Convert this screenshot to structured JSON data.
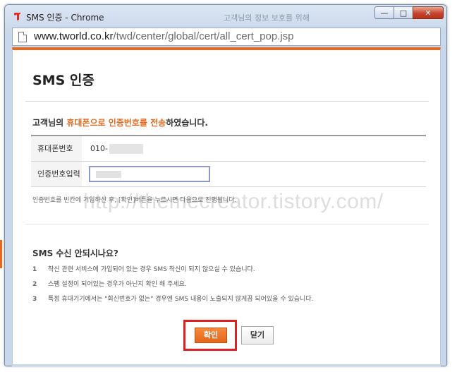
{
  "window": {
    "title": "SMS 인증 - Chrome",
    "background_tab_text": "고객님의 정보 보호를 위해",
    "controls": {
      "minimize": "—",
      "maximize": "□",
      "close": "✕"
    }
  },
  "address": {
    "domain": "www.tworld.co.kr",
    "path": "/twd/center/global/cert/all_cert_pop.jsp"
  },
  "popup": {
    "title": "SMS 인증",
    "notice": {
      "prefix": "고객님의 ",
      "highlight1": "휴대폰으로 인증번호를 전송",
      "suffix": "하였습니다."
    },
    "form": {
      "phone_label": "휴대폰번호",
      "phone_value": "010-",
      "code_label": "인증번호입력",
      "code_placeholder": ""
    },
    "help_text": "인증번호를 빈칸에 기입하신 후, [확인]버튼을 누르시면 다음으로 진행됩니다.",
    "watermark": "http://themecreator.tistory.com/",
    "faq": {
      "title": "SMS 수신 안되시나요?",
      "items": [
        {
          "num": "1",
          "text": "착신 관련 서비스에 가입되어 있는 경우 SMS 착신이 되지 않으실 수 있습니다."
        },
        {
          "num": "2",
          "text": "스팸 설정이 되어있는 경우가 아닌지 확인 해 주세요."
        },
        {
          "num": "3",
          "text": "특정 휴대기기에서는 \"회신번호가 없는\" 경우엔 SMS 내용이 노출되지 않게끔 되어있을 수 있습니다."
        }
      ]
    },
    "buttons": {
      "confirm": "확인",
      "close": "닫기"
    }
  },
  "colors": {
    "accent": "#e8691d",
    "highlight_box": "#e02020"
  },
  "icons": {
    "app": "tworld-logo-icon",
    "page": "page-icon"
  }
}
